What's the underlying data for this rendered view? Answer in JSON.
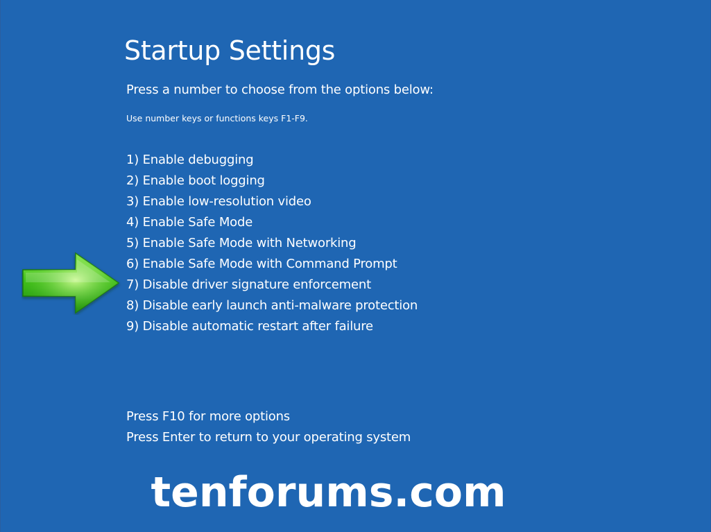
{
  "title": "Startup Settings",
  "subtitle": "Press a number to choose from the options below:",
  "hint": "Use number keys or functions keys F1-F9.",
  "options": [
    "1) Enable debugging",
    "2) Enable boot logging",
    "3) Enable low-resolution video",
    "4) Enable Safe Mode",
    "5) Enable Safe Mode with Networking",
    "6) Enable Safe Mode with Command Prompt",
    "7) Disable driver signature enforcement",
    "8) Disable early launch anti-malware protection",
    "9) Disable automatic restart after failure"
  ],
  "highlighted_option_index": 6,
  "footer": {
    "more_options": "Press F10 for more options",
    "return": "Press Enter to return to your operating system"
  },
  "watermark": "tenforums.com",
  "colors": {
    "background": "#1f66b3",
    "text": "#ffffff",
    "arrow": "#3fbf1a"
  },
  "icons": {
    "pointer": "green-arrow-icon"
  }
}
